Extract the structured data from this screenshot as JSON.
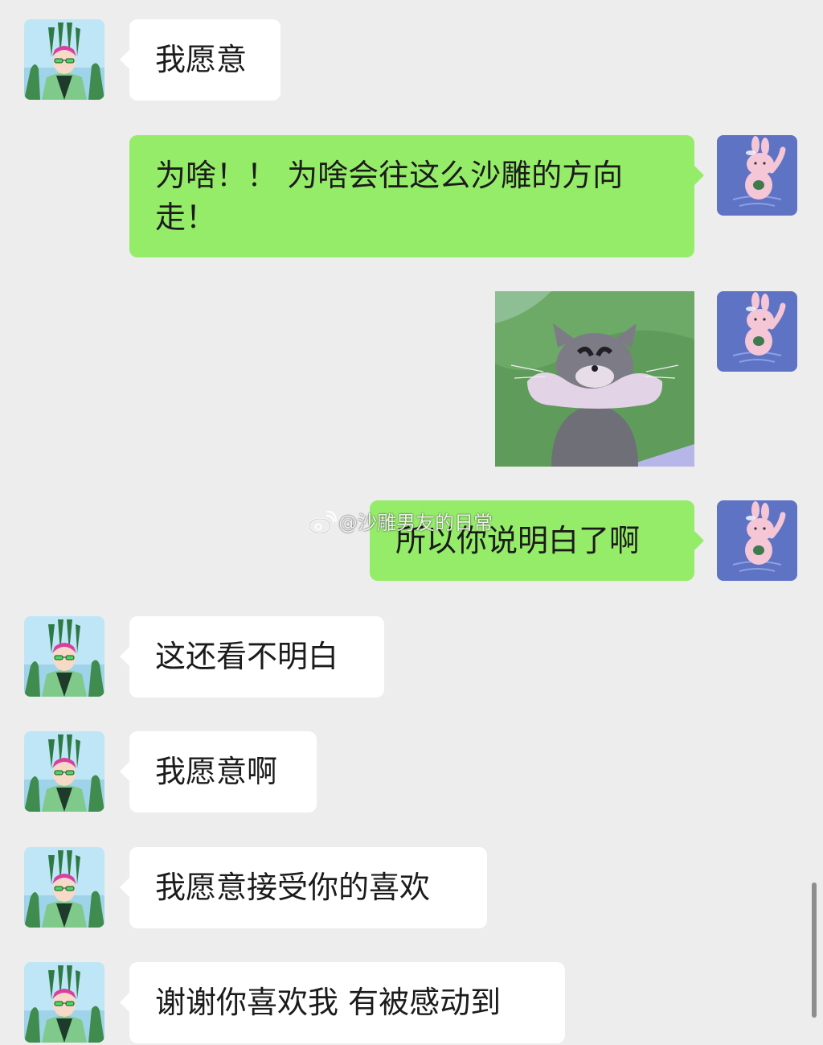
{
  "chat": {
    "messages": [
      {
        "sender": "friend",
        "type": "text",
        "text": "我愿意"
      },
      {
        "sender": "me",
        "type": "text",
        "text": "为啥！！ 为啥会往这么沙雕的方向\n走！"
      },
      {
        "sender": "me",
        "type": "sticker",
        "sticker": "tom-cat-arms-crossed-sticker"
      },
      {
        "sender": "me",
        "type": "text",
        "text": "所以你说明白了啊"
      },
      {
        "sender": "friend",
        "type": "text",
        "text": "这还看不明白"
      },
      {
        "sender": "friend",
        "type": "text",
        "text": "我愿意啊"
      },
      {
        "sender": "friend",
        "type": "text",
        "text": "我愿意接受你的喜欢"
      },
      {
        "sender": "friend",
        "type": "text",
        "text": "谢谢你喜欢我 有被感动到"
      }
    ]
  },
  "watermark": {
    "text": "@沙雕男友的日常",
    "icon": "weibo-icon"
  },
  "colors": {
    "background": "#ededed",
    "incoming_bubble": "#ffffff",
    "outgoing_bubble": "#95ec69",
    "text": "#1b1b1b"
  },
  "avatars": {
    "friend": "green-haired-anime-boy-avatar",
    "me": "pink-rabbit-avatar"
  }
}
